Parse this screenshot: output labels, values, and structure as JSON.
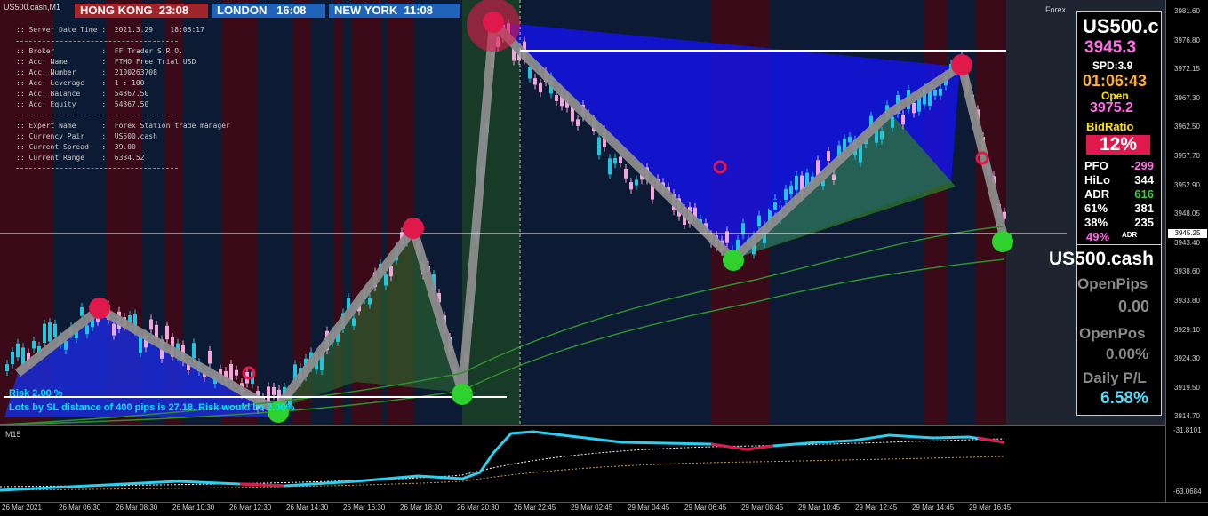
{
  "symbol_label": "US500.cash,M1",
  "clocks": [
    {
      "label": "HONG KONG  23:08"
    },
    {
      "label": "LONDON   16:08"
    },
    {
      "label": "NEW YORK  11:08"
    }
  ],
  "info": {
    "server_date": ":: Server Date Time :  2021.3.29    18:08:17",
    "account_lines": [
      ":: Broker           :  FF Trader S.R.O.",
      ":: Acc. Name        :  FTMO Free Trial USD",
      ":: Acc. Number      :  2100263708",
      ":: Acc. Leverage    :  1 : 100",
      ":: Acc. Balance     :  54367.50",
      ":: Acc. Equity      :  54367.50"
    ],
    "ea_lines": [
      ":: Expert Name      :  Forex Station trade manager",
      ":: Currency Pair    :  US500.cash",
      ":: Current Spread   :  39.00",
      ":: Current Range    :  6334.52"
    ]
  },
  "forex_label": "Forex",
  "risk": {
    "line1": "Risk 2.00 %",
    "line2": "Lots by SL distance of 400 pips is 27.18. Risk would be 2.00%"
  },
  "y_axis_ticks": [
    "3981.60",
    "3976.80",
    "3972.15",
    "3967.30",
    "3962.50",
    "3957.70",
    "3952.90",
    "3948.05",
    "3943.40",
    "3938.60",
    "3933.80",
    "3929.10",
    "3924.30",
    "3919.50",
    "3914.70"
  ],
  "current_price_tag": "3945.25",
  "panel": {
    "symbol": "US500.c",
    "price": "3945.3",
    "spread": "SPD:3.9",
    "timer": "01:06:43",
    "open_label": "Open",
    "open_value": "3975.2",
    "bidratio_label": "BidRatio",
    "bidratio_value": "12%",
    "stats": [
      {
        "label": "PFO",
        "value": "-299"
      },
      {
        "label": "HiLo",
        "value": "344"
      },
      {
        "label": "ADR",
        "value": "616"
      },
      {
        "label": "61%",
        "value": "381"
      },
      {
        "label": "38%",
        "value": "235"
      }
    ],
    "adr_pct": "49%",
    "adr_small": "ADR",
    "symbol_full": "US500.cash",
    "openpips_label": "OpenPips",
    "openpips_value": "0.00",
    "openpos_label": "OpenPos",
    "openpos_value": "0.00%",
    "daily_label": "Daily P/L",
    "daily_value": "6.58%"
  },
  "sub_label": "M15",
  "sub_ticks": [
    "-31.8101",
    "-63.0684"
  ],
  "x_axis_ticks": [
    "26 Mar 2021",
    "26 Mar 06:30",
    "26 Mar 08:30",
    "26 Mar 10:30",
    "26 Mar 12:30",
    "26 Mar 14:30",
    "26 Mar 16:30",
    "26 Mar 18:30",
    "26 Mar 20:30",
    "26 Mar 22:45",
    "29 Mar 02:45",
    "29 Mar 04:45",
    "29 Mar 06:45",
    "29 Mar 08:45",
    "29 Mar 10:45",
    "29 Mar 12:45",
    "29 Mar 14:45",
    "29 Mar 16:45"
  ],
  "colors": {
    "bull": "#1fc6e0",
    "bear": "#f0a6d8",
    "session_red": "#3a0a18",
    "zigzag": "#8c8c8c",
    "pivot_high": "#e0194c",
    "pivot_low": "#2ed12e",
    "ma": "#2f8f2f",
    "osc": "#2ad0f0",
    "panel_price": "#ff6ee6",
    "timer": "#ffb02e",
    "open_value": "#ff6ee6",
    "bidratio_bg": "#e0194c",
    "daily": "#4ae0ff"
  }
}
